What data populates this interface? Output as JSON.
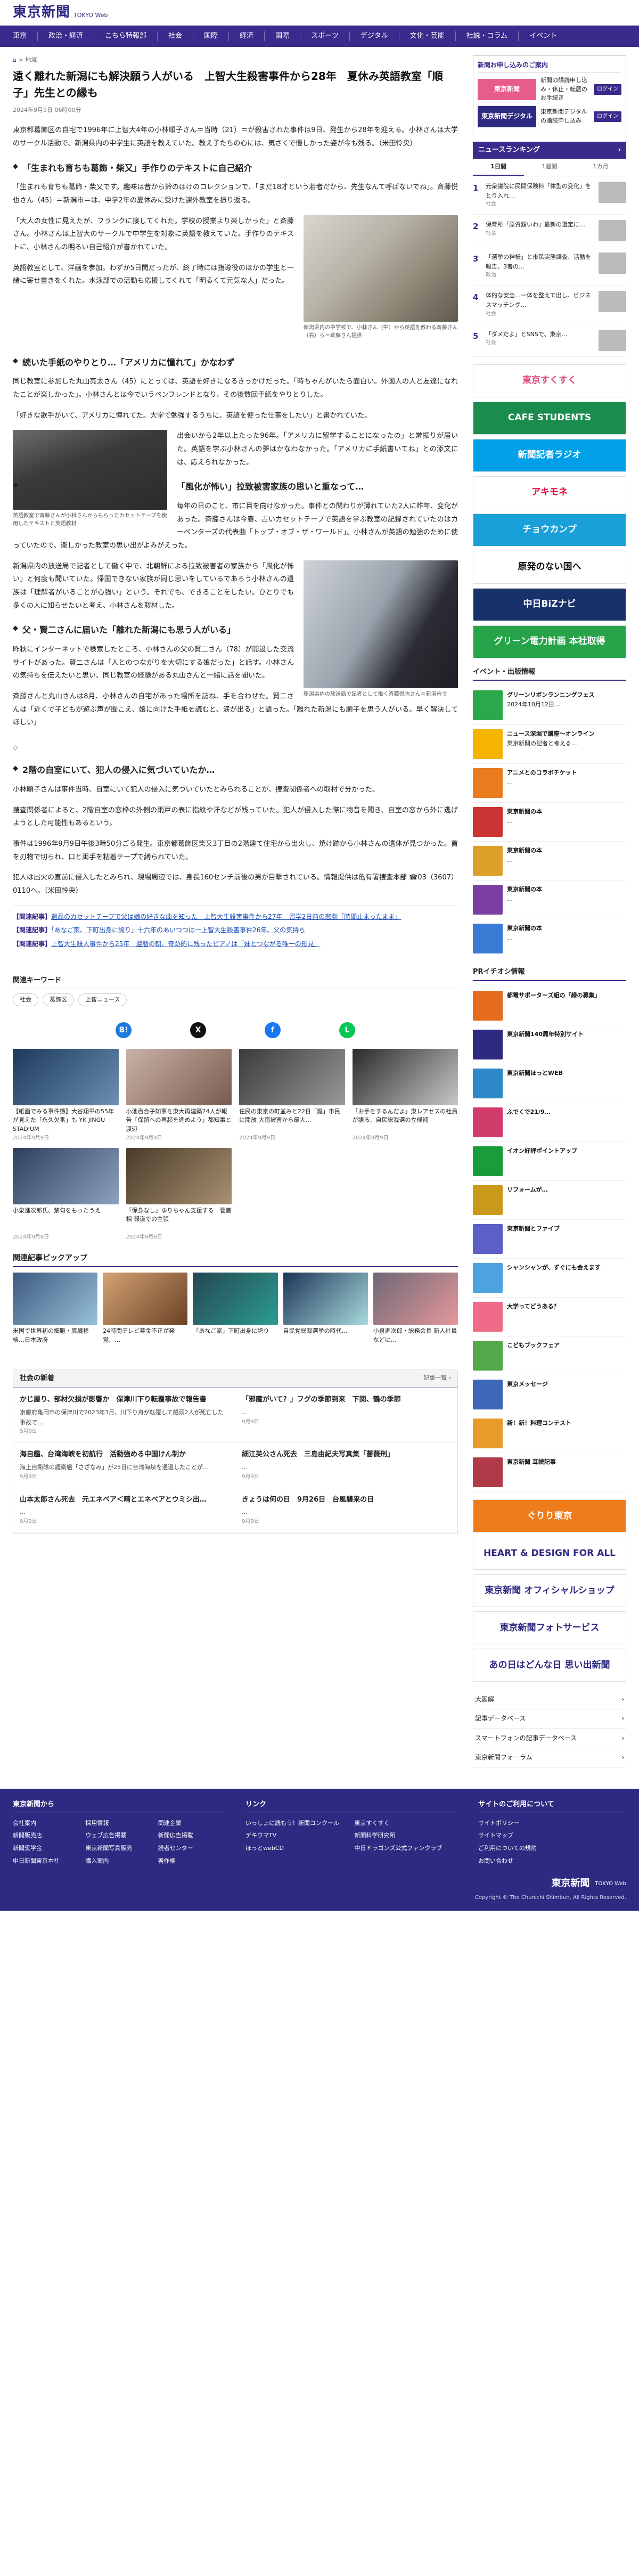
{
  "header": {
    "logo": "東京新聞",
    "logo_sub": "TOKYO Web"
  },
  "nav": [
    "東京",
    "政治・経済",
    "こちら特報部",
    "社会",
    "国際",
    "経済",
    "国際",
    "スポーツ",
    "デジタル",
    "文化・芸能",
    "社説・コラム",
    "イベント"
  ],
  "breadcrumb": {
    "home": "⌂",
    "sep": ">",
    "cat": "地域"
  },
  "article": {
    "title": "遠く離れた新潟にも解決願う人がいる　上智大生殺害事件から28年　夏休み英語教室「順子」先生との縁も",
    "date": "2024年9月9日 06時00分",
    "lead": "東京都葛飾区の自宅で1996年に上智大4年の小林順子さん＝当時（21）＝が殺害された事件は9日、発生から28年を迎える。小林さんは大学のサークル活動で、新潟県内の中学生に英語を教えていた。教え子たちの心には、気さくで優しかった姿が今も残る。（米田怜央）",
    "s1": "「生まれも育ちも葛飾・柴又」手作りのテキストに自己紹介",
    "p1": "「生まれも育ちも葛飾・柴又です。趣味は昔から鈴のはけのコレクションで、「まだ18才という若者だから、先生なんて呼ばないでね」。斉藤悦也さん（45）＝新潟市＝は、中学2年の夏休みに受けた課外教室を振り返る。",
    "p2": "「大人の女性に見えたが、フランクに接してくれた。学校の授業より楽しかった」と斉藤さん。小林さんは上智大のサークルで中学生を対象に英語を教えていた。手作りのテキストに、小林さんの明るい自己紹介が書かれていた。",
    "p3": "英語教室として、洋画を参加。わずか5日間だったが、終了時には指導役のほかの学生と一緒に寄せ書きをくれた。水泳部での活動も応援してくれて「明るくて元気な人」だった。",
    "cap1": "新潟県内の中学校で、小林さん（中）から英語を教わる斉藤さん（右）ら＝斉藤さん提供",
    "s2": "続いた手紙のやりとり…「アメリカに憧れて」かなわず",
    "p4": "同じ教室に参加した丸山亮太さん（45）にとっては、英語を好きになるきっかけだった。「時ちゃんがいたら面白い。外国人の人と友達になれたことが楽しかった」。小林さんとは今でいうペンフレンドとなり、その後数回手紙をやりとりした。",
    "p5": "「好きな歌手がいて、アメリカに憧れてた。大学で勉強するうちに、英語を使った仕事をしたい」と書かれていた。",
    "cap2": "英語教室で斉藤さんが小林さんからもらったカセットテープを使用したテキストと英語教材",
    "p6": "出会いから2年以上たった96年。「アメリカに留学することになったの」と常振りが届いた。英語を学ぶ小林さんの夢はかなわなかった。「アメリカに手紙書いてね」との添文には、応えられなかった。",
    "s3": "「風化が怖い」拉致被害家族の思いと重なって…",
    "p7": "毎年の日のこと、市に目を向けなかった。事件との関わりが薄れていた2人に昨年、変化があった。斉藤さんは今春、古いカセットテープで英語を学ぶ教室の記録されていたのはカーペンターズの代表曲「トップ・オブ・ザ・ワールド」。小林さんが英語の勉強のために使っていたので、楽しかった教室の思い出がよみがえった。",
    "p8": "新潟県内の放送局で記者として働く中で、北朝鮮による拉致被害者の家族から「風化が怖い」と何度も聞いていた。帰国できない家族が同じ思いをしているであろう小林さんの遺族は「理解者がいることが心強い」という。それでも、できることをしたい。ひとりでも多くの人に知らせたいと考え、小林さんを取材した。",
    "cap3": "新潟県内の放送局で記者として働く斉藤悦也さん＝新潟市で",
    "s4": "父・賢二さんに届いた「離れた新潟にも思う人がいる」",
    "p9": "昨秋にインターネットで検索したところ、小林さんの父の賢二さん（78）が開設した交流サイトがあった。賢二さんは「人とのつながりを大切にする娘だった」と話す。小林さんの気持ちを伝えたいと思い、同じ教室の経験がある丸山さんと一緒に話を聞いた。",
    "p10": "斉藤さんと丸山さんは8月、小林さんの自宅があった場所を訪ね、手を合わせた。賢二さんは「近くで子どもが遊ぶ声が聞こえ、娘に向けた手紙を読むと、涙が出る」と語った。「離れた新潟にも順子を思う人がいる。早く解決してほしい」",
    "sep": "◇",
    "s5": "2階の自室にいて、犯人の侵入に気づいていたか…",
    "p11": "小林順子さんは事件当時、自室にいて犯人の侵入に気づいていたとみられることが、捜査関係者への取材で分かった。",
    "p12": "捜査関係者によると、2階自室の窓枠の外側の雨戸の表に指紋や汗などが残っていた。犯人が侵入した際に物音を聞き、自室の窓から外に逃げようとした可能性もあるという。",
    "p13": "事件は1996年9月9日午後3時50分ごろ発生。東京都葛飾区柴又3丁目の2階建て住宅から出火し、焼け跡から小林さんの遺体が見つかった。首を刃物で切られ、口と両手を粘着テープで縛られていた。",
    "p14": "犯人は出火の直前に侵入したとみられ、現場周辺では、身長160センチ前後の男が目撃されている。情報提供は亀有署捜査本部 ☎03（3607）0110へ。（米田怜央）",
    "related": [
      {
        "tag": "【関連記事】",
        "text": "遺品のカセットテープで父は娘の好きな曲を知った　上智大生殺害事件から27年　留学2日前の悲劇「時間止まったまま」"
      },
      {
        "tag": "【関連記事】",
        "text": "「あなご家、下町出身に誇り」十六年のあいつつは一上智大生殺害事件26年、父の気持ち"
      },
      {
        "tag": "【関連記事】",
        "text": "上智大生殺人事件から25年　還暦の朝、奇跡的に残ったピアノは「妹とつながる唯一の形見」"
      }
    ]
  },
  "keywords": {
    "head": "関連キーワード",
    "items": [
      "社会",
      "葛飾区",
      "上智ニュース"
    ]
  },
  "share": [
    {
      "label": "B!",
      "color": "#1d7be0"
    },
    {
      "label": "X",
      "color": "#111111"
    },
    {
      "label": "f",
      "color": "#1877f2"
    },
    {
      "label": "L",
      "color": "#06c755"
    }
  ],
  "cards": [
    {
      "title": "【紙面でみる事件簿】大谷翔平の55年が見えた「永久欠番」も YK JINGU STADIUM",
      "date": "2024年9月9日",
      "c1": "#1b3a5b",
      "c2": "#6e8fb2"
    },
    {
      "title": "小池百合子知事を東大再建築24人が報告「保留への再起を進めよう」都知事と渡辺",
      "date": "2024年9月9日",
      "c1": "#c9b2a8",
      "c2": "#7a5a4f"
    },
    {
      "title": "住民の東京の町並みと22日「鍵」市民に開放 大雨被害から最大…",
      "date": "2024年9月9日",
      "c1": "#3a3a3a",
      "c2": "#9a9a9a"
    },
    {
      "title": "「お手をするんだよ」東レアセスの社員が語る、自民総裁選の立候補",
      "date": "2024年9月9日",
      "c1": "#2a2a2a",
      "c2": "#c8c8c8"
    },
    {
      "title": "小泉進次郎氏、禁句をもったうえ",
      "date": "2024年9月8日",
      "c1": "#2d3f5c",
      "c2": "#8da2c0"
    },
    {
      "title": "「保身なし」ゆりちゃん支援する　菅首相 報道での主張",
      "date": "2024年9月8日",
      "c1": "#4b3b2a",
      "c2": "#a89070"
    }
  ],
  "picks": {
    "head": "関連記事ピックアップ",
    "items": [
      {
        "title": "米国で世界初の細胞・膵臓移植…日本政府",
        "c1": "#3d5a80",
        "c2": "#98c1d9"
      },
      {
        "title": "24時間テレビ募金不正が発覚、…",
        "c1": "#d4a373",
        "c2": "#6b4226"
      },
      {
        "title": "「あなご家」下町出身に誇り",
        "c1": "#264653",
        "c2": "#2a9d8f"
      },
      {
        "title": "自民党総裁選挙の時代…",
        "c1": "#1d3557",
        "c2": "#a8dadc"
      },
      {
        "title": "小泉進次郎・総務会長 新人社員などに…",
        "c1": "#6d6875",
        "c2": "#e5989b"
      }
    ]
  },
  "news": {
    "head": "社会の新着",
    "more": "記事一覧 ›",
    "items": [
      {
        "title": "かじ屋り、部材欠損が影響か　保津川下り転覆事故で報告書",
        "body": "京都府亀岡市の保津川で2023年3月、川下り舟が転覆して船頭2人が死亡した事故で…",
        "date": "9月9日"
      },
      {
        "title": "「邪魔がいて？」フグの季節到来　下関、鶴の季節",
        "body": "…",
        "date": "9月9日"
      },
      {
        "title": "海自艦、台湾海峡を初航行　活動強める中国けん制か",
        "body": "海上自衛隊の護衛艦「さざなみ」が25日に台湾海峡を通過したことが…",
        "date": "9月9日"
      },
      {
        "title": "細江英公さん死去　三島由紀夫写真集「薔薇刑」",
        "body": "…",
        "date": "9月9日"
      },
      {
        "title": "山本太郎さん死去　元エネベア＜晴とエネべアとウミシ出…",
        "body": "…",
        "date": "9月9日"
      },
      {
        "title": "きょうは何の日　9月26日　台風襲来の日",
        "body": "…",
        "date": "9月9日"
      }
    ]
  },
  "sidebar": {
    "subscribe": {
      "head": "新聞お申し込みのご案内",
      "rows": [
        {
          "logo": "東京新聞",
          "text": "新聞の購読申し込み・休止・転居のお手続き",
          "btn": "ログイン",
          "color": "#e85c8a"
        },
        {
          "logo": "東京新聞デジタル",
          "text": "東京新聞デジタルの購読申し込み",
          "btn": "ログイン",
          "color": "#2e2a82"
        }
      ]
    },
    "ranking": {
      "head": "ニュースランキング",
      "more": "›",
      "tabs": [
        "1日間",
        "1週間",
        "1カ月"
      ],
      "items": [
        {
          "text": "元衆議院に民間保険料「体型の変化」をとり入れ…",
          "cat": "社会"
        },
        {
          "text": "保育所「原資額いわ」最新の選定に…",
          "cat": "社会"
        },
        {
          "text": "「選挙の神様」と市民実態調査、活動を報告、3者の…",
          "cat": "政治"
        },
        {
          "text": "体的な安全…一体を整えて出し、ビジネスマッチング…",
          "cat": "社会"
        },
        {
          "text": "「ダメだよ」とSNSで、東京…",
          "cat": "社会"
        }
      ]
    },
    "ads": [
      {
        "text": "東京すくすく",
        "bg": "#ffffff",
        "fg": "#e04a7a"
      },
      {
        "text": "CAFE STUDENTS",
        "bg": "#1a8c4e",
        "fg": "#ffffff"
      },
      {
        "text": "新聞記者ラジオ",
        "bg": "#00a0e9",
        "fg": "#ffffff"
      },
      {
        "text": "アキモネ",
        "bg": "#ffffff",
        "fg": "#e2003a"
      },
      {
        "text": "チョウカンプ",
        "bg": "#1aa0d8",
        "fg": "#ffffff"
      },
      {
        "text": "原発のない国へ",
        "bg": "#ffffff",
        "fg": "#111111"
      },
      {
        "text": "中日BiZナビ",
        "bg": "#17316b",
        "fg": "#ffffff"
      },
      {
        "text": "グリーン電力計画 本社取得",
        "bg": "#27a34a",
        "fg": "#ffffff"
      }
    ],
    "events": {
      "head": "イベント・出版情報",
      "items": [
        {
          "title": "グリーンリボンランニングフェス",
          "body": "2024年10月12日…",
          "c": "#2aa84a"
        },
        {
          "title": "ニュース深堀で講座〜オンライン",
          "body": "東京新聞の記者と考える…",
          "c": "#f4b400"
        },
        {
          "title": "アニメとのコラボチケット",
          "body": "…",
          "c": "#e97c1f"
        },
        {
          "title": "東京新聞の本",
          "body": "…",
          "c": "#cc3333"
        },
        {
          "title": "東京新聞の本",
          "body": "…",
          "c": "#dba02a"
        },
        {
          "title": "東京新聞の本",
          "body": "…",
          "c": "#7a3fa0"
        },
        {
          "title": "東京新聞の本",
          "body": "…",
          "c": "#3a7bd5"
        }
      ]
    },
    "pr": {
      "head": "PRイチオシ情報",
      "items": [
        {
          "title": "都電サポーターズ組の「緑の募集」",
          "c": "#e56b1f"
        },
        {
          "title": "東京新聞140周年特別サイト",
          "c": "#2e2a82"
        },
        {
          "title": "東京新聞ほっとWEB",
          "c": "#2e89c8"
        },
        {
          "title": "ふでくで21/9…",
          "c": "#d23c6a"
        },
        {
          "title": "イオン好評ポイントアップ",
          "c": "#1a9c3a"
        },
        {
          "title": "リフォームが…",
          "c": "#c99a19"
        },
        {
          "title": "東京新聞とファイブ",
          "c": "#5b5fc7"
        },
        {
          "title": "シャンシャンが、ずぐにも会えます",
          "c": "#4ca3dd"
        },
        {
          "title": "大学ってどうある？",
          "c": "#ef6b88"
        },
        {
          "title": "こどもブックフェア",
          "c": "#54a849"
        },
        {
          "title": "東京メッセージ",
          "c": "#3f67b8"
        },
        {
          "title": "新！新！料理コンテスト",
          "c": "#e89a2a"
        },
        {
          "title": "東京新聞 耳読記事",
          "c": "#b03a48"
        }
      ]
    },
    "bottom_ads": [
      {
        "text": "ぐりり東京",
        "bg": "#ef7c1a",
        "fg": "#ffffff"
      },
      {
        "text": "HEART & DESIGN FOR ALL",
        "bg": "#ffffff",
        "fg": "#2e2a82"
      },
      {
        "text": "東京新聞 オフィシャルショップ",
        "bg": "#ffffff",
        "fg": "#2e2a82"
      },
      {
        "text": "東京新聞フォトサービス",
        "bg": "#ffffff",
        "fg": "#2e2a82"
      },
      {
        "text": "あの日はどんな日 思い出新聞",
        "bg": "#ffffff",
        "fg": "#2e2a82"
      }
    ],
    "cats": [
      "大図解",
      "記事データベース",
      "スマートフォンの記事データベース",
      "東京新聞フォーラム"
    ]
  },
  "footer": {
    "col1": {
      "head": "東京新聞から",
      "items": [
        "会社案内",
        "採用情報",
        "関連企業",
        "新聞販売店",
        "ウェブ広告掲載",
        "新聞広告掲載",
        "新聞奨学金",
        "東京新聞写真販売",
        "読者センター",
        "中日新聞東京本社",
        "購入案内",
        "著作権"
      ]
    },
    "col2": {
      "head": "リンク",
      "items": [
        "いっしょに読もう！新聞コンクール",
        "東京すくすく",
        "デキウマTV",
        "新聞科学研究所",
        "ほっとwebCD",
        "中日ドラゴンズ公式ファンクラブ"
      ]
    },
    "col3": {
      "head": "サイトのご利用について",
      "items": [
        "サイトポリシー",
        "サイトマップ",
        "ご利用についての規約",
        "お問い合わせ"
      ]
    },
    "logo": "東京新聞",
    "logo_sub": "TOKYO Web",
    "copyright": "Copyright © The Chunichi Shimbun, All Rights Reserved."
  }
}
